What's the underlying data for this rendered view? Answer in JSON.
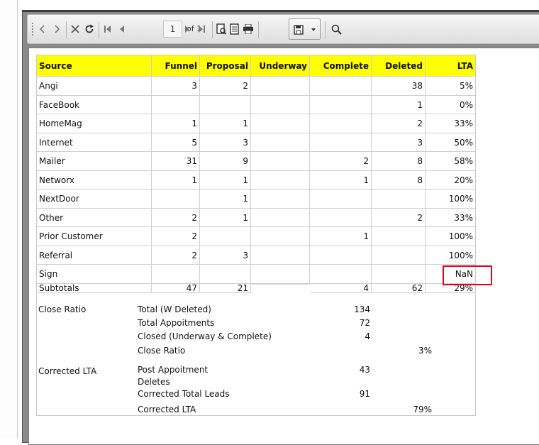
{
  "toolbar": {
    "page_number": "1",
    "page_of": "of 1",
    "icons": [
      "grip-icon",
      "back-arrow-icon",
      "forward-arrow-icon",
      "stop-icon",
      "refresh-icon",
      "first-page-icon",
      "previous-page-icon",
      "next-page-icon",
      "last-page-icon",
      "page-setup-icon",
      "document-map-icon",
      "print-icon",
      "save-icon",
      "dropdown-arrow-icon",
      "search-icon"
    ]
  },
  "table": {
    "headers": [
      "Source",
      "Funnel",
      "Proposal",
      "Underway",
      "Complete",
      "Deleted",
      "LTA"
    ],
    "rows": [
      [
        "Angi",
        "3",
        "2",
        "",
        "",
        "38",
        "5%"
      ],
      [
        "FaceBook",
        "",
        "",
        "",
        "",
        "1",
        "0%"
      ],
      [
        "HomeMag",
        "1",
        "1",
        "",
        "",
        "2",
        "33%"
      ],
      [
        "Internet",
        "5",
        "3",
        "",
        "",
        "3",
        "50%"
      ],
      [
        "Mailer",
        "31",
        "9",
        "",
        "2",
        "8",
        "58%"
      ],
      [
        "Networx",
        "1",
        "1",
        "",
        "1",
        "8",
        "20%"
      ],
      [
        "NextDoor",
        "",
        "1",
        "",
        "",
        "",
        "100%"
      ],
      [
        "Other",
        "2",
        "1",
        "",
        "",
        "2",
        "33%"
      ],
      [
        "Prior Customer",
        "2",
        "",
        "",
        "1",
        "",
        "100%"
      ],
      [
        "Referral",
        "2",
        "3",
        "",
        "",
        "",
        "100%"
      ],
      [
        "Sign",
        "",
        "",
        "",
        "",
        "",
        "NaN"
      ]
    ],
    "subtotals": [
      "Subtotals",
      "47",
      "21",
      "",
      "4",
      "62",
      "29%"
    ]
  },
  "summary": {
    "close_ratio": {
      "heading": "Close Ratio",
      "lines": [
        {
          "label": "Total (W Deleted)",
          "value": "134",
          "pct": ""
        },
        {
          "label": "Total Appoitments",
          "value": "72",
          "pct": ""
        },
        {
          "label": "Closed (Underway & Complete)",
          "value": "4",
          "pct": ""
        },
        {
          "label": "Close Ratio",
          "value": "",
          "pct": "3%"
        }
      ]
    },
    "corrected_lta": {
      "heading": "Corrected LTA",
      "lines": [
        {
          "label": "Post Appoitment",
          "value": "43",
          "pct": ""
        },
        {
          "label": "Deletes",
          "value": "",
          "pct": ""
        },
        {
          "label": "Corrected Total Leads",
          "value": "91",
          "pct": ""
        },
        {
          "label": "Corrected LTA",
          "value": "",
          "pct": "79%"
        }
      ]
    }
  },
  "colors": {
    "header_bg": "#ffff00",
    "highlight": "#e0001b",
    "toolbar": "#e4e4e4"
  }
}
